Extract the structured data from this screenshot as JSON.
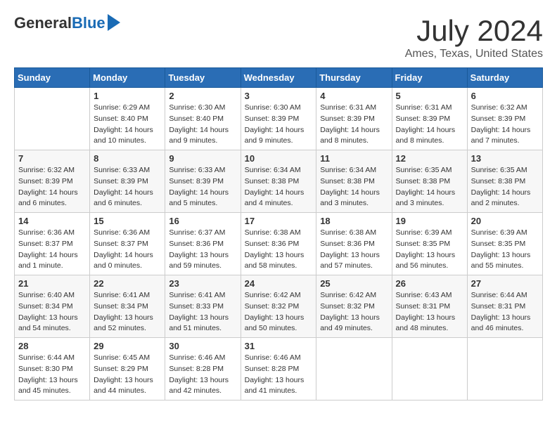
{
  "header": {
    "logo_general": "General",
    "logo_blue": "Blue",
    "title": "July 2024",
    "location": "Ames, Texas, United States"
  },
  "calendar": {
    "days_of_week": [
      "Sunday",
      "Monday",
      "Tuesday",
      "Wednesday",
      "Thursday",
      "Friday",
      "Saturday"
    ],
    "weeks": [
      [
        {
          "day": "",
          "info": ""
        },
        {
          "day": "1",
          "info": "Sunrise: 6:29 AM\nSunset: 8:40 PM\nDaylight: 14 hours and 10 minutes."
        },
        {
          "day": "2",
          "info": "Sunrise: 6:30 AM\nSunset: 8:40 PM\nDaylight: 14 hours and 9 minutes."
        },
        {
          "day": "3",
          "info": "Sunrise: 6:30 AM\nSunset: 8:39 PM\nDaylight: 14 hours and 9 minutes."
        },
        {
          "day": "4",
          "info": "Sunrise: 6:31 AM\nSunset: 8:39 PM\nDaylight: 14 hours and 8 minutes."
        },
        {
          "day": "5",
          "info": "Sunrise: 6:31 AM\nSunset: 8:39 PM\nDaylight: 14 hours and 8 minutes."
        },
        {
          "day": "6",
          "info": "Sunrise: 6:32 AM\nSunset: 8:39 PM\nDaylight: 14 hours and 7 minutes."
        }
      ],
      [
        {
          "day": "7",
          "info": "Sunrise: 6:32 AM\nSunset: 8:39 PM\nDaylight: 14 hours and 6 minutes."
        },
        {
          "day": "8",
          "info": "Sunrise: 6:33 AM\nSunset: 8:39 PM\nDaylight: 14 hours and 6 minutes."
        },
        {
          "day": "9",
          "info": "Sunrise: 6:33 AM\nSunset: 8:39 PM\nDaylight: 14 hours and 5 minutes."
        },
        {
          "day": "10",
          "info": "Sunrise: 6:34 AM\nSunset: 8:38 PM\nDaylight: 14 hours and 4 minutes."
        },
        {
          "day": "11",
          "info": "Sunrise: 6:34 AM\nSunset: 8:38 PM\nDaylight: 14 hours and 3 minutes."
        },
        {
          "day": "12",
          "info": "Sunrise: 6:35 AM\nSunset: 8:38 PM\nDaylight: 14 hours and 3 minutes."
        },
        {
          "day": "13",
          "info": "Sunrise: 6:35 AM\nSunset: 8:38 PM\nDaylight: 14 hours and 2 minutes."
        }
      ],
      [
        {
          "day": "14",
          "info": "Sunrise: 6:36 AM\nSunset: 8:37 PM\nDaylight: 14 hours and 1 minute."
        },
        {
          "day": "15",
          "info": "Sunrise: 6:36 AM\nSunset: 8:37 PM\nDaylight: 14 hours and 0 minutes."
        },
        {
          "day": "16",
          "info": "Sunrise: 6:37 AM\nSunset: 8:36 PM\nDaylight: 13 hours and 59 minutes."
        },
        {
          "day": "17",
          "info": "Sunrise: 6:38 AM\nSunset: 8:36 PM\nDaylight: 13 hours and 58 minutes."
        },
        {
          "day": "18",
          "info": "Sunrise: 6:38 AM\nSunset: 8:36 PM\nDaylight: 13 hours and 57 minutes."
        },
        {
          "day": "19",
          "info": "Sunrise: 6:39 AM\nSunset: 8:35 PM\nDaylight: 13 hours and 56 minutes."
        },
        {
          "day": "20",
          "info": "Sunrise: 6:39 AM\nSunset: 8:35 PM\nDaylight: 13 hours and 55 minutes."
        }
      ],
      [
        {
          "day": "21",
          "info": "Sunrise: 6:40 AM\nSunset: 8:34 PM\nDaylight: 13 hours and 54 minutes."
        },
        {
          "day": "22",
          "info": "Sunrise: 6:41 AM\nSunset: 8:34 PM\nDaylight: 13 hours and 52 minutes."
        },
        {
          "day": "23",
          "info": "Sunrise: 6:41 AM\nSunset: 8:33 PM\nDaylight: 13 hours and 51 minutes."
        },
        {
          "day": "24",
          "info": "Sunrise: 6:42 AM\nSunset: 8:32 PM\nDaylight: 13 hours and 50 minutes."
        },
        {
          "day": "25",
          "info": "Sunrise: 6:42 AM\nSunset: 8:32 PM\nDaylight: 13 hours and 49 minutes."
        },
        {
          "day": "26",
          "info": "Sunrise: 6:43 AM\nSunset: 8:31 PM\nDaylight: 13 hours and 48 minutes."
        },
        {
          "day": "27",
          "info": "Sunrise: 6:44 AM\nSunset: 8:31 PM\nDaylight: 13 hours and 46 minutes."
        }
      ],
      [
        {
          "day": "28",
          "info": "Sunrise: 6:44 AM\nSunset: 8:30 PM\nDaylight: 13 hours and 45 minutes."
        },
        {
          "day": "29",
          "info": "Sunrise: 6:45 AM\nSunset: 8:29 PM\nDaylight: 13 hours and 44 minutes."
        },
        {
          "day": "30",
          "info": "Sunrise: 6:46 AM\nSunset: 8:28 PM\nDaylight: 13 hours and 42 minutes."
        },
        {
          "day": "31",
          "info": "Sunrise: 6:46 AM\nSunset: 8:28 PM\nDaylight: 13 hours and 41 minutes."
        },
        {
          "day": "",
          "info": ""
        },
        {
          "day": "",
          "info": ""
        },
        {
          "day": "",
          "info": ""
        }
      ]
    ]
  }
}
